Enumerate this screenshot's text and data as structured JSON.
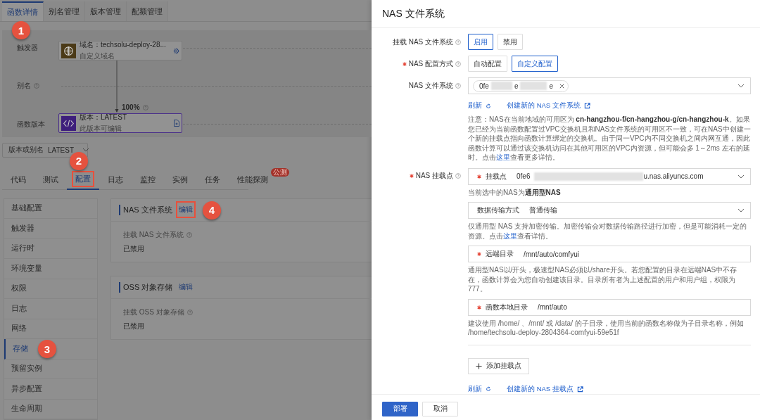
{
  "page": {
    "tabs": [
      {
        "label": "函数详情",
        "selected": true,
        "step": "1"
      },
      {
        "label": "别名管理",
        "selected": false
      },
      {
        "label": "版本管理",
        "selected": false
      },
      {
        "label": "配额管理",
        "selected": false
      }
    ],
    "topology": {
      "rows": [
        {
          "label": "触发器",
          "help": false
        },
        {
          "label": "别名",
          "help": true
        },
        {
          "label": "函数版本",
          "help": false
        }
      ],
      "trigger_node": {
        "title": "域名：techsolu-deploy-28...",
        "subtitle": "自定义域名"
      },
      "edge": {
        "label": "100%"
      },
      "version_node": {
        "title": "版本：LATEST",
        "subtitle": "此版本可编辑"
      }
    },
    "version_select": {
      "label": "版本或别名",
      "value": "LATEST"
    },
    "sub_tabs": [
      {
        "label": "代码",
        "selected": false
      },
      {
        "label": "测试",
        "selected": false
      },
      {
        "label": "配置",
        "selected": true,
        "step": "2",
        "highlighted": true
      },
      {
        "label": "日志",
        "selected": false
      },
      {
        "label": "监控",
        "selected": false
      },
      {
        "label": "实例",
        "selected": false
      },
      {
        "label": "任务",
        "selected": false
      },
      {
        "label": "性能探测",
        "selected": false,
        "badge": "公测"
      }
    ],
    "sidebar": {
      "items": [
        {
          "label": "基础配置",
          "selected": false
        },
        {
          "label": "触发器",
          "selected": false
        },
        {
          "label": "运行时",
          "selected": false
        },
        {
          "label": "环境变量",
          "selected": false
        },
        {
          "label": "权限",
          "selected": false
        },
        {
          "label": "日志",
          "selected": false
        },
        {
          "label": "网络",
          "selected": false
        },
        {
          "label": "存储",
          "selected": true,
          "step": "3"
        },
        {
          "label": "预留实例",
          "selected": false
        },
        {
          "label": "异步配置",
          "selected": false
        },
        {
          "label": "生命周期",
          "selected": false
        }
      ]
    },
    "cards": [
      {
        "title": "NAS 文件系统",
        "edit": "编辑",
        "edit_highlighted": true,
        "step": "4",
        "field_label": "挂载 NAS 文件系统",
        "value": "已禁用"
      },
      {
        "title": "OSS 对象存储",
        "edit": "编辑",
        "edit_highlighted": false,
        "field_label": "挂载 OSS 对象存储",
        "value": "已禁用"
      }
    ]
  },
  "drawer": {
    "title": "NAS 文件系统",
    "mount_toggle": {
      "label": "挂载 NAS 文件系统",
      "required": false,
      "options": [
        {
          "label": "启用",
          "selected": true
        },
        {
          "label": "禁用",
          "selected": false
        }
      ]
    },
    "config_mode": {
      "label": "NAS 配置方式",
      "required": true,
      "options": [
        {
          "label": "自动配置",
          "selected": false
        },
        {
          "label": "自定义配置",
          "selected": true
        }
      ]
    },
    "filesystem": {
      "label": "NAS 文件系统",
      "required": false,
      "tag_parts": [
        "0fe",
        "e",
        "e"
      ],
      "refresh": "刷新",
      "create_link": "创建新的 NAS 文件系统",
      "note": {
        "before": "注意：NAS在当前地域的可用区为 **cn-hangzhou-f/cn-hangzhou-g/cn-hangzhou-k**。如果您已经为当前函数配置过VPC交换机且和NAS文件系统的可用区不一致，可在NAS中创建一个新的挂载点指向函数计算绑定的交换机。由于同一VPC内不同交换机之间内网互通，因此函数计算可以通过该交换机访问在其他可用区的VPC内资源，但可能会多 1～2ms 左右的延时。点击",
        "link": "这里",
        "after": "查看更多详情。"
      }
    },
    "mount_point": {
      "label": "NAS 挂载点",
      "required": true,
      "fields": [
        {
          "kind": "select",
          "label": "挂载点",
          "required": true,
          "value_parts": [
            "0fe6",
            "u.nas.aliyuncs.com"
          ],
          "hint": {
            "before": "当前选中的NAS为**通用型NAS**"
          }
        },
        {
          "kind": "select",
          "label": "数据传输方式",
          "required": false,
          "value_parts": [
            "普通传输"
          ],
          "hint": {
            "before": "仅通用型 NAS 支持加密传输。加密传输会对数据传输路径进行加密，但是可能消耗一定的资源。点击",
            "link": "这里",
            "after": "查看详情。"
          }
        },
        {
          "kind": "input",
          "label": "远端目录",
          "required": true,
          "value_parts": [
            "/mnt/auto/comfyui"
          ],
          "hint": {
            "before": "通用型NAS以/开头，极速型NAS必须以/share开头。若您配置的目录在远端NAS中不存在，函数计算会为您自动创建该目录。目录所有者为上述配置的用户和用户组，权限为777。"
          }
        },
        {
          "kind": "input",
          "label": "函数本地目录",
          "required": true,
          "value_parts": [
            "/mnt/auto"
          ],
          "hint": {
            "before": "建议使用 /home/ 、/mnt/ 或 /data/ 的子目录，使用当前的函数名称做为子目录名称，例如 /home/techsolu-deploy-2804364-comfyui-59e51f"
          }
        }
      ],
      "add_button": "添加挂载点",
      "refresh": "刷新",
      "create_link": "创建新的 NAS 挂载点"
    },
    "buttons": [
      {
        "label": "部署",
        "kind": "primary"
      },
      {
        "label": "取消",
        "kind": "default"
      }
    ]
  }
}
